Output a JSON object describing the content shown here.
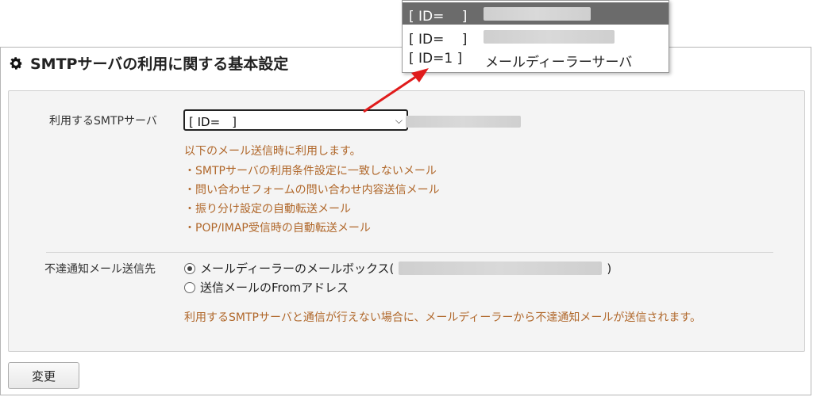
{
  "title": "SMTPサーバの利用に関する基本設定",
  "smtp": {
    "label": "利用するSMTPサーバ",
    "selected": "[ ID=　]",
    "notes": [
      "以下のメール送信時に利用します。",
      "・SMTPサーバの利用条件設定に一致しないメール",
      "・問い合わせフォームの問い合わせ内容送信メール",
      "・振り分け設定の自動転送メール",
      "・POP/IMAP受信時の自動転送メール"
    ]
  },
  "bounce": {
    "label": "不達通知メール送信先",
    "option1_prefix": "メールディーラーのメールボックス(",
    "option1_suffix": ")",
    "option2": "送信メールのFromアドレス",
    "note": "利用するSMTPサーバと通信が行えない場合に、メールディーラーから不達通知メールが送信されます。"
  },
  "dropdown": {
    "options": [
      {
        "id": "[ ID=　 ]",
        "name": ""
      },
      {
        "id": "[ ID=　 ]",
        "name": ""
      },
      {
        "id": "[ ID=1 ]",
        "name": "メールディーラーサーバ"
      }
    ]
  },
  "button": {
    "change": "変更"
  },
  "colors": {
    "note": "#b0672a",
    "arrow": "#e01b1b",
    "selected_option": "#6b6b6b"
  }
}
